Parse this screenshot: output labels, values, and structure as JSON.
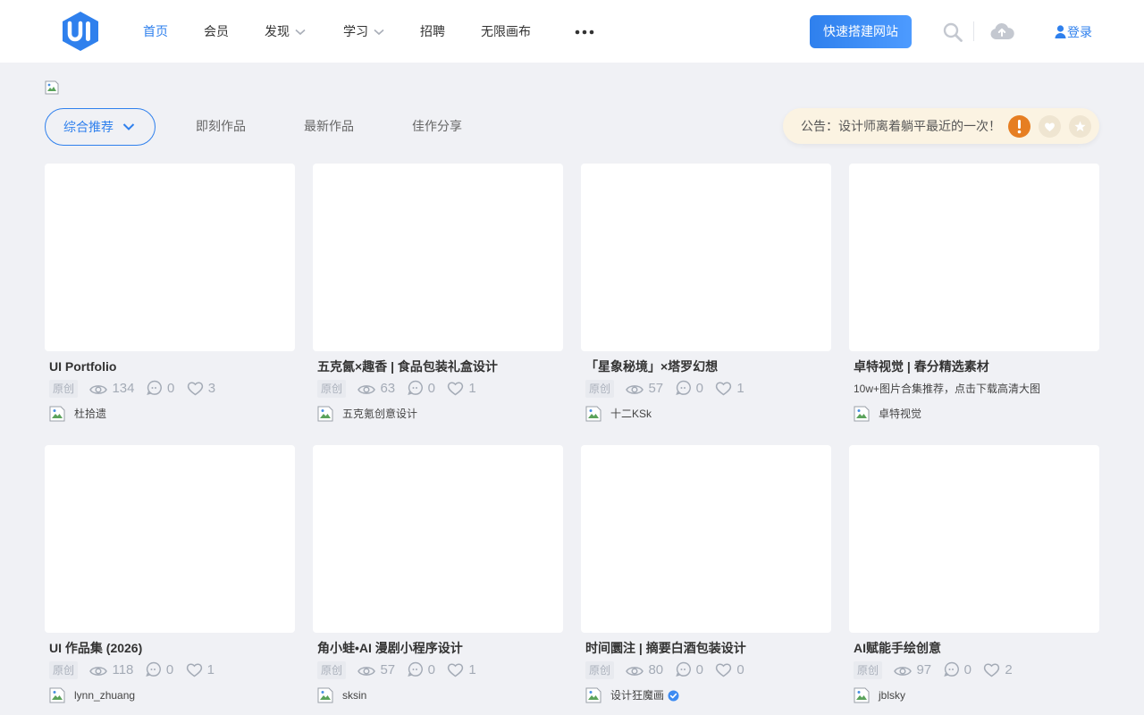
{
  "nav": {
    "items": [
      {
        "label": "首页"
      },
      {
        "label": "会员"
      },
      {
        "label": "发现"
      },
      {
        "label": "学习"
      },
      {
        "label": "招聘"
      },
      {
        "label": "无限画布"
      }
    ],
    "cta_label": "快速搭建网站",
    "login_label": "登录",
    "brand_color": "#2f80ed"
  },
  "filters": {
    "primary": "综合推荐",
    "tabs": [
      "即刻作品",
      "最新作品",
      "佳作分享"
    ]
  },
  "notice": {
    "text": "公告：设计师离着躺平最近的一次！"
  },
  "cards": [
    {
      "title": "UI Portfolio",
      "tag": "原创",
      "views": "134",
      "comments": "0",
      "likes": "3",
      "author": "杜拾遗"
    },
    {
      "title": "五克氤×趣香 | 食品包装礼盒设计",
      "tag": "原创",
      "views": "63",
      "comments": "0",
      "likes": "1",
      "author": "五克氪创意设计"
    },
    {
      "title": "「星象秘境」×塔罗幻想",
      "tag": "原创",
      "views": "57",
      "comments": "0",
      "likes": "1",
      "author": "十二KSk"
    },
    {
      "title": "卓特视觉 | 春分精选素材",
      "desc": "10w+图片合集推荐，点击下载高清大图",
      "author": "卓特视觉"
    },
    {
      "title": "UI 作品集 (2026)",
      "tag": "原创",
      "views": "118",
      "comments": "0",
      "likes": "1",
      "author": "lynn_zhuang"
    },
    {
      "title": "角小蛙•AI 漫剧小程序设计",
      "tag": "原创",
      "views": "57",
      "comments": "0",
      "likes": "1",
      "author": "sksin"
    },
    {
      "title": "时间圜注 | 摘要白酒包装设计",
      "tag": "原创",
      "views": "80",
      "comments": "0",
      "likes": "0",
      "author": "设计狂魔画",
      "verified": true
    },
    {
      "title": "AI赋能手绘创意",
      "tag": "原创",
      "views": "97",
      "comments": "0",
      "likes": "2",
      "author": "jblsky"
    }
  ]
}
